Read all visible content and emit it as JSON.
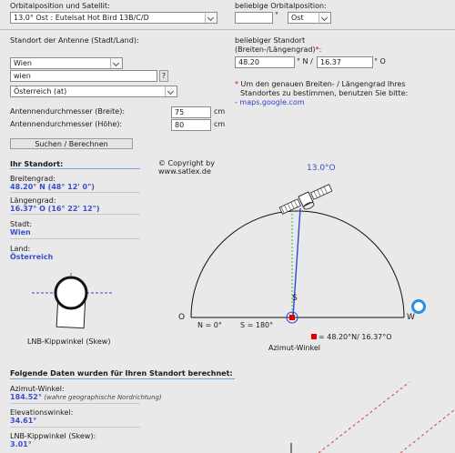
{
  "orbit": {
    "label": "Orbitalposition und Satellit:",
    "satellite_value": "13.0° Ost : Eutelsat Hot Bird 13B/C/D",
    "custom_label": "beliebige Orbitalposition:",
    "degree_symbol": "°",
    "direction_value": "Ost"
  },
  "location": {
    "label": "Standort der Antenne (Stadt/Land):",
    "city_select": "Wien",
    "city_input": "wien",
    "help_button": "?",
    "country_select": "Österreich (at)"
  },
  "custom_location": {
    "label_line1": "beliebiger Standort",
    "label_line2": "(Breiten-/Längengrad)",
    "required_mark": "*:",
    "lat_value": "48.20",
    "lat_unit": "° N /",
    "lon_value": "16.37",
    "lon_unit": "° O",
    "note_star": "*",
    "note_line1": "Um den genauen Breiten- / Längengrad Ihres",
    "note_line2": "Standortes zu bestimmen, benutzen Sie bitte:",
    "note_link": "- maps.google.com"
  },
  "dish": {
    "width_label": "Antennendurchmesser (Breite):",
    "width_value": "75",
    "height_label": "Antennendurchmesser (Höhe):",
    "height_value": "80",
    "unit": "cm"
  },
  "search_button": "Suchen / Berechnen",
  "your_location": {
    "title": "Ihr Standort:",
    "lat_label": "Breitengrad:",
    "lat_value": "48.20° N (48° 12' 0\")",
    "lon_label": "Längengrad:",
    "lon_value": "16.37° O (16° 22' 12\")",
    "city_label": "Stadt:",
    "city_value": "Wien",
    "country_label": "Land:",
    "country_value": "Österreich"
  },
  "diagram": {
    "copyright_line1": "© Copyright by",
    "copyright_line2": "www.satlex.de",
    "orbit_value": "13.0°O",
    "south": "S",
    "west": "W",
    "east": "O",
    "north_label": "N = 0°",
    "south_label": "S = 180°",
    "legend": "= 48.20°N/ 16.37°O",
    "azimuth_caption": "Azimut-Winkel",
    "azimuth_deg": 184.52,
    "orbit_deg": 13.0
  },
  "skew_caption": "LNB-Kippwinkel (Skew)",
  "results": {
    "title": "Folgende Daten wurden für Ihren Standort berechnet:",
    "azimuth_label": "Azimut-Winkel:",
    "azimuth_value": "184.52°",
    "azimuth_note": "(wahre geographische Nordrichtung)",
    "elevation_label": "Elevationswinkel:",
    "elevation_value": "34.61°",
    "skew_label": "LNB-Kippwinkel (Skew):",
    "skew_value": "3.01°"
  },
  "colors": {
    "value_blue": "#3a4fd0",
    "marker_red": "#e00000",
    "ring_blue": "#2a8fe0"
  }
}
